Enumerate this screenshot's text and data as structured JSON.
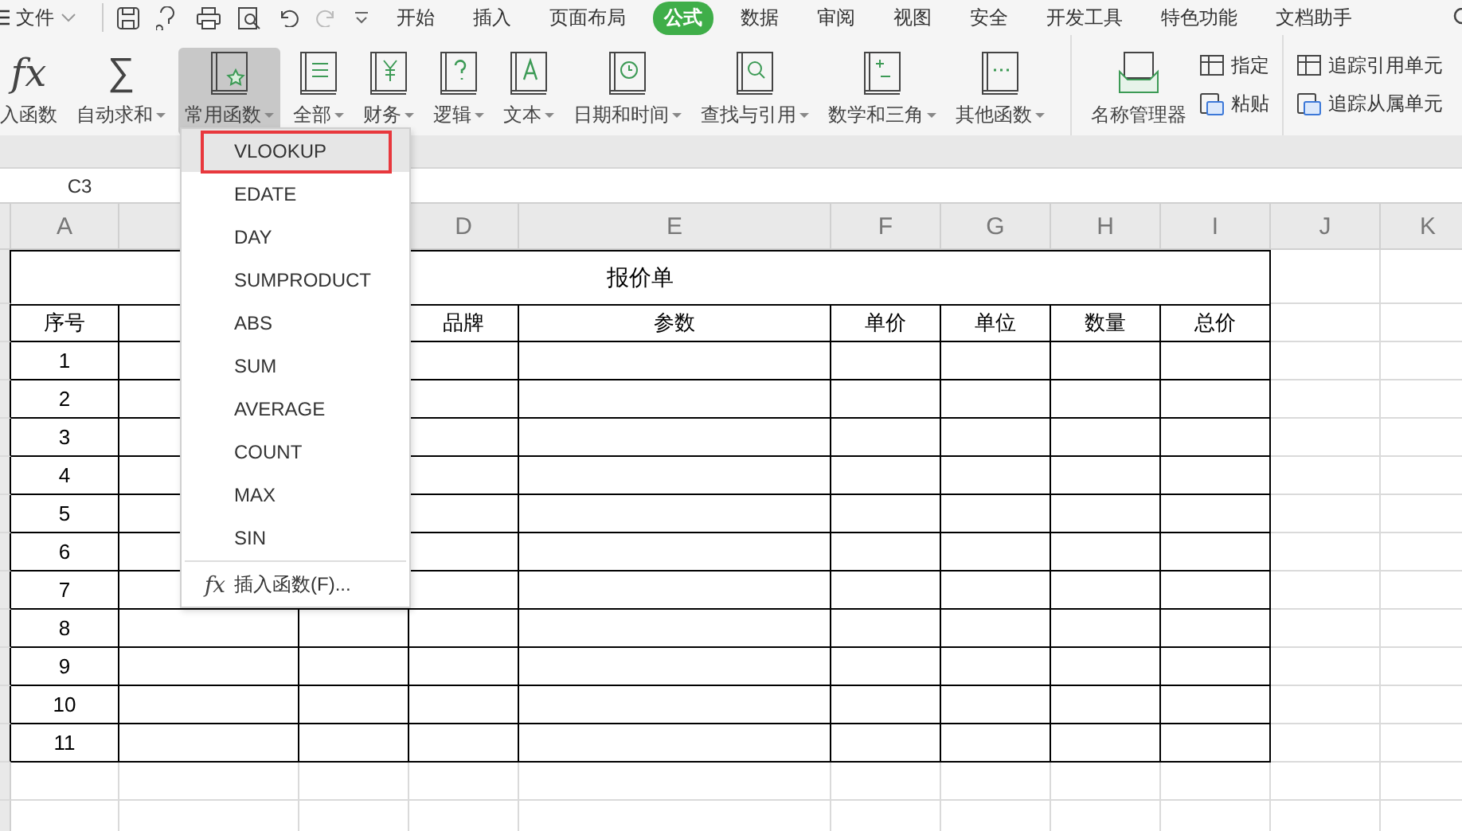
{
  "top": {
    "file": "文件",
    "tabs": [
      {
        "label": "开始",
        "selected": false
      },
      {
        "label": "插入",
        "selected": false
      },
      {
        "label": "页面布局",
        "selected": false
      },
      {
        "label": "公式",
        "selected": true
      },
      {
        "label": "数据",
        "selected": false
      },
      {
        "label": "审阅",
        "selected": false
      },
      {
        "label": "视图",
        "selected": false
      },
      {
        "label": "安全",
        "selected": false
      },
      {
        "label": "开发工具",
        "selected": false
      },
      {
        "label": "特色功能",
        "selected": false
      },
      {
        "label": "文档助手",
        "selected": false
      }
    ]
  },
  "ribbon": [
    {
      "kind": "glyph",
      "icon": "fx",
      "label": "入函数",
      "active": false
    },
    {
      "kind": "glyph",
      "icon": "∑",
      "label": "自动求和",
      "dropdown": true,
      "active": false
    },
    {
      "kind": "book",
      "label": "常用函数",
      "dropdown": true,
      "active": true
    },
    {
      "kind": "book",
      "label": "全部",
      "dropdown": true,
      "active": false
    },
    {
      "kind": "book",
      "label": "财务",
      "dropdown": true,
      "active": false
    },
    {
      "kind": "book",
      "label": "逻辑",
      "dropdown": true,
      "active": false
    },
    {
      "kind": "book",
      "label": "文本",
      "dropdown": true,
      "active": false
    },
    {
      "kind": "book",
      "label": "日期和时间",
      "dropdown": true,
      "active": false
    },
    {
      "kind": "book",
      "label": "查找与引用",
      "dropdown": true,
      "active": false
    },
    {
      "kind": "book",
      "label": "数学和三角",
      "dropdown": true,
      "active": false
    },
    {
      "kind": "book",
      "label": "其他函数",
      "dropdown": true,
      "active": false
    },
    {
      "kind": "divider"
    },
    {
      "kind": "book",
      "label": "名称管理器",
      "active": false
    },
    {
      "kind": "stack",
      "items": [
        "指定",
        "粘贴"
      ]
    },
    {
      "kind": "divider"
    },
    {
      "kind": "stack",
      "items": [
        "追踪引用单元",
        "追踪从属单元"
      ]
    }
  ],
  "sheet": {
    "name_box": "C3",
    "columns_left": [
      "A"
    ],
    "columns_right": [
      "D",
      "E",
      "F",
      "G",
      "H",
      "I",
      "J",
      "K"
    ],
    "title": "报价单",
    "header_left": [
      "序号"
    ],
    "header_right": [
      "品牌",
      "参数",
      "单价",
      "单位",
      "数量",
      "总价"
    ],
    "rows": [
      "1",
      "2",
      "3",
      "4",
      "5",
      "6",
      "7",
      "8",
      "9",
      "10",
      "11"
    ]
  },
  "dropdown": {
    "items": [
      {
        "label": "VLOOKUP",
        "selected": true
      },
      {
        "label": "EDATE",
        "selected": false
      },
      {
        "label": "DAY",
        "selected": false
      },
      {
        "label": "SUMPRODUCT",
        "selected": false
      },
      {
        "label": "ABS",
        "selected": false
      },
      {
        "label": "SUM",
        "selected": false
      },
      {
        "label": "AVERAGE",
        "selected": false
      },
      {
        "label": "COUNT",
        "selected": false
      },
      {
        "label": "MAX",
        "selected": false
      },
      {
        "label": "SIN",
        "selected": false
      }
    ],
    "footer": {
      "icon": "fx",
      "label": "插入函数(F)..."
    }
  }
}
